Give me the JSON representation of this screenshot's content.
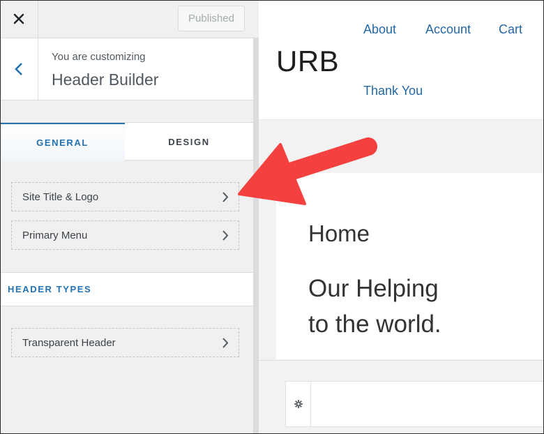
{
  "topbar": {
    "publish_label": "Published"
  },
  "breadcrumb": {
    "subtitle": "You are customizing",
    "title": "Header Builder"
  },
  "tabs": [
    {
      "label": "GENERAL"
    },
    {
      "label": "DESIGN"
    }
  ],
  "general_items": [
    {
      "label": "Site Title & Logo"
    },
    {
      "label": "Primary Menu"
    }
  ],
  "header_types": {
    "heading": "HEADER TYPES",
    "items": [
      {
        "label": "Transparent Header"
      }
    ]
  },
  "preview": {
    "site_title": "URB",
    "nav": [
      {
        "label": "About"
      },
      {
        "label": "Account"
      },
      {
        "label": "Cart"
      },
      {
        "label": "Thank You"
      }
    ],
    "page_title": "Home",
    "hero_line1": "Our Helping",
    "hero_line2": "to the world."
  },
  "colors": {
    "accent": "#2271b1",
    "arrow": "#f4403f",
    "nav_link": "#2468a6"
  }
}
